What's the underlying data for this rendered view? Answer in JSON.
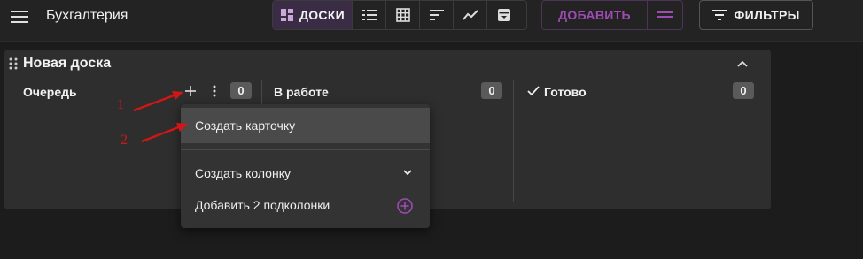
{
  "app": {
    "title": "Бухгалтерия"
  },
  "toolbar": {
    "views": [
      {
        "name": "boards",
        "label": "ДОСКИ",
        "icon": "dashboard-icon",
        "active": true
      },
      {
        "name": "list",
        "icon": "list-icon"
      },
      {
        "name": "table",
        "icon": "grid-icon"
      },
      {
        "name": "gantt",
        "icon": "sort-lines-icon"
      },
      {
        "name": "chart",
        "icon": "trend-icon"
      },
      {
        "name": "archive",
        "icon": "archive-icon"
      }
    ],
    "add_label": "ДОБАВИТЬ",
    "filters_label": "ФИЛЬТРЫ",
    "accent_color": "#a04ab5"
  },
  "board": {
    "title": "Новая доска",
    "columns": [
      {
        "title": "Очередь",
        "count": "0"
      },
      {
        "title": "В работе",
        "count": "0"
      },
      {
        "title": "Готово",
        "count": "0",
        "icon": "check-icon"
      }
    ]
  },
  "context_menu": {
    "items": [
      {
        "label": "Создать карточку",
        "highlighted": true
      },
      {
        "label": "Создать колонку",
        "icon": "chevron-down-icon"
      },
      {
        "label": "Добавить 2 подколонки",
        "icon": "add-circle-icon"
      }
    ]
  },
  "annotations": {
    "marker_1": "1",
    "marker_2": "2",
    "color": "#d21616"
  }
}
